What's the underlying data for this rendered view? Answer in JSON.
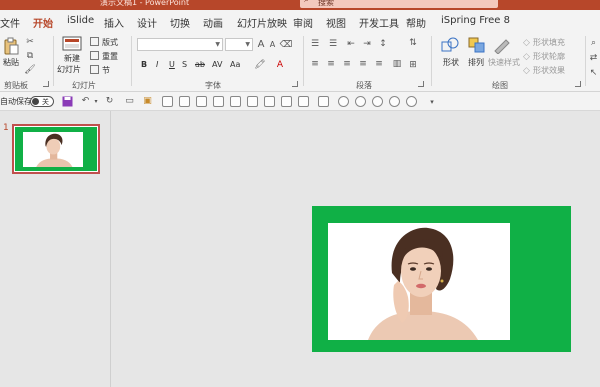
{
  "window": {
    "title": "演示文稿1 - PowerPoint",
    "search_placeholder": "搜索"
  },
  "tabs": [
    "文件",
    "开始",
    "iSlide",
    "插入",
    "设计",
    "切换",
    "动画",
    "幻灯片放映",
    "审阅",
    "视图",
    "开发工具",
    "帮助",
    "iSpring Free 8"
  ],
  "active_tab": "开始",
  "ribbon": {
    "clipboard": {
      "paste": "粘贴",
      "label": "剪贴板"
    },
    "slides": {
      "new_slide": "新建\n幻灯片",
      "new_slide_line1": "新建",
      "new_slide_line2": "幻灯片",
      "layout": "版式",
      "reset": "重置",
      "section": "节",
      "label": "幻灯片"
    },
    "font": {
      "label": "字体",
      "bold": "B",
      "italic": "I",
      "underline": "U",
      "strike": "S",
      "shadow": "ab",
      "spacing": "AV",
      "case": "Aa",
      "grow": "A",
      "shrink": "A"
    },
    "paragraph": {
      "label": "段落"
    },
    "drawing": {
      "shape": "形状",
      "arrange": "排列",
      "quick_styles": "快速样式",
      "shape_fill": "形状填充",
      "shape_outline": "形状轮廓",
      "shape_effects": "形状效果",
      "label": "绘图"
    }
  },
  "qat": {
    "autosave_label": "自动保存",
    "toggle_state": "关"
  },
  "slides_pane": {
    "slide_number": "1"
  },
  "colors": {
    "accent": "#b7472a",
    "slide_green": "#10b046",
    "thumb_border": "#c0504d"
  }
}
